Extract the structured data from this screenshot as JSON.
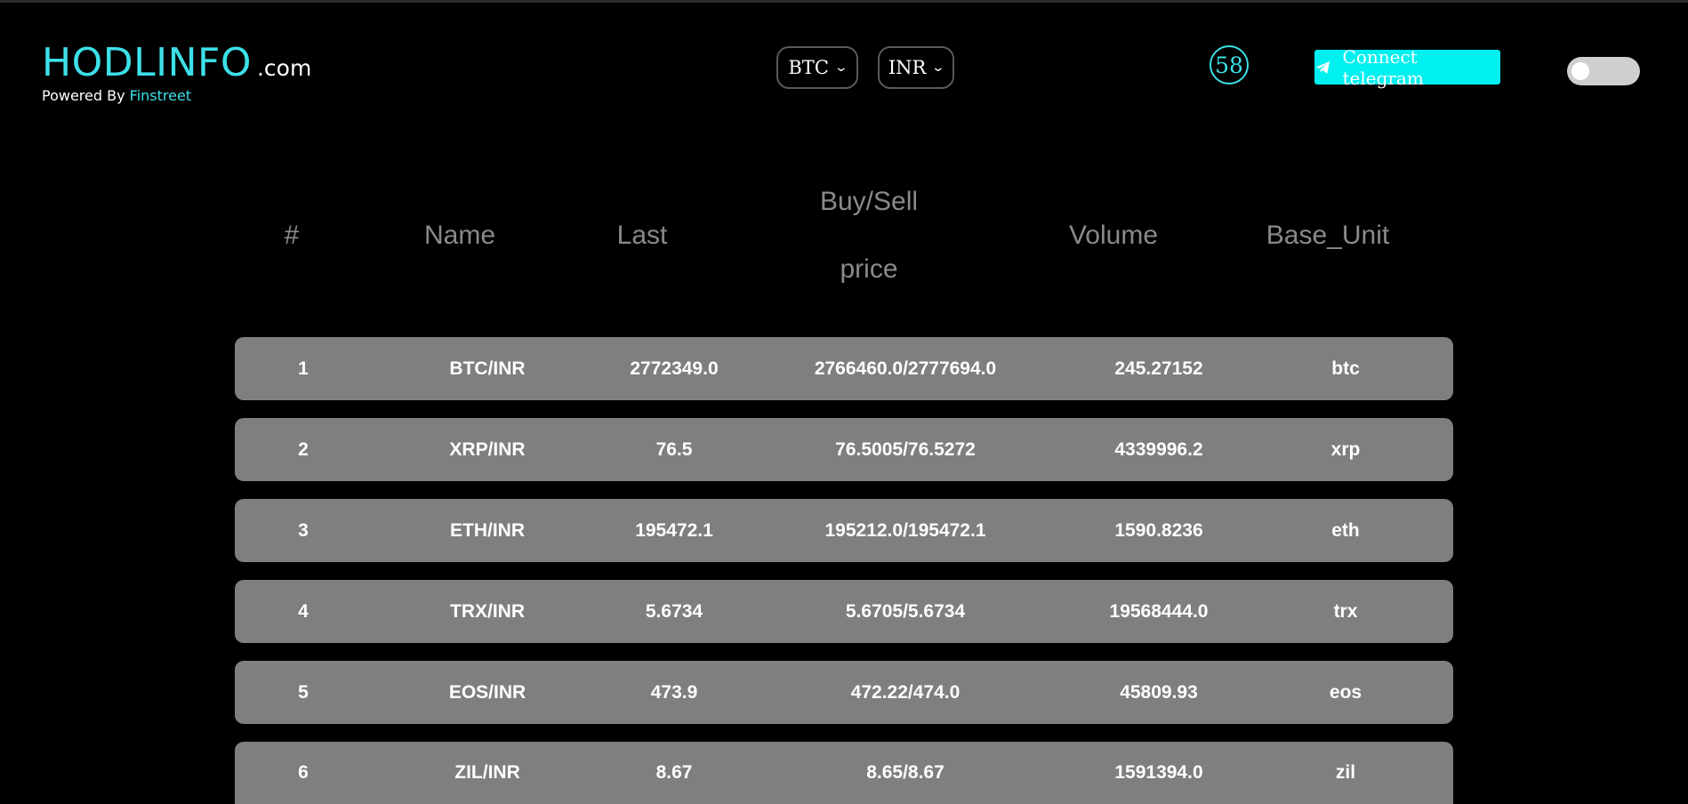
{
  "brand": {
    "title": "HODLINFO",
    "suffix": ".com",
    "powered_prefix": "Powered By",
    "powered_link": "Finstreet"
  },
  "selectors": {
    "crypto": "BTC",
    "currency": "INR"
  },
  "timer": "58",
  "telegram_button": "Connect telegram",
  "theme_toggle": {
    "state": "off"
  },
  "table": {
    "headers": {
      "num": "#",
      "name": "Name",
      "last": "Last",
      "buysell_line1": "Buy/Sell",
      "buysell_line2": "price",
      "volume": "Volume",
      "base_unit": "Base_Unit"
    },
    "rows": [
      {
        "num": "1",
        "name": "BTC/INR",
        "last": "2772349.0",
        "buysell": "2766460.0/2777694.0",
        "volume": "245.27152",
        "base": "btc"
      },
      {
        "num": "2",
        "name": "XRP/INR",
        "last": "76.5",
        "buysell": "76.5005/76.5272",
        "volume": "4339996.2",
        "base": "xrp"
      },
      {
        "num": "3",
        "name": "ETH/INR",
        "last": "195472.1",
        "buysell": "195212.0/195472.1",
        "volume": "1590.8236",
        "base": "eth"
      },
      {
        "num": "4",
        "name": "TRX/INR",
        "last": "5.6734",
        "buysell": "5.6705/5.6734",
        "volume": "19568444.0",
        "base": "trx"
      },
      {
        "num": "5",
        "name": "EOS/INR",
        "last": "473.9",
        "buysell": "472.22/474.0",
        "volume": "45809.93",
        "base": "eos"
      },
      {
        "num": "6",
        "name": "ZIL/INR",
        "last": "8.67",
        "buysell": "8.65/8.67",
        "volume": "1591394.0",
        "base": "zil"
      }
    ]
  },
  "colors": {
    "accent": "#3de0e8",
    "telegram_bg": "#00f0f0",
    "row_bg": "#7f7f7f",
    "background": "#000000"
  }
}
